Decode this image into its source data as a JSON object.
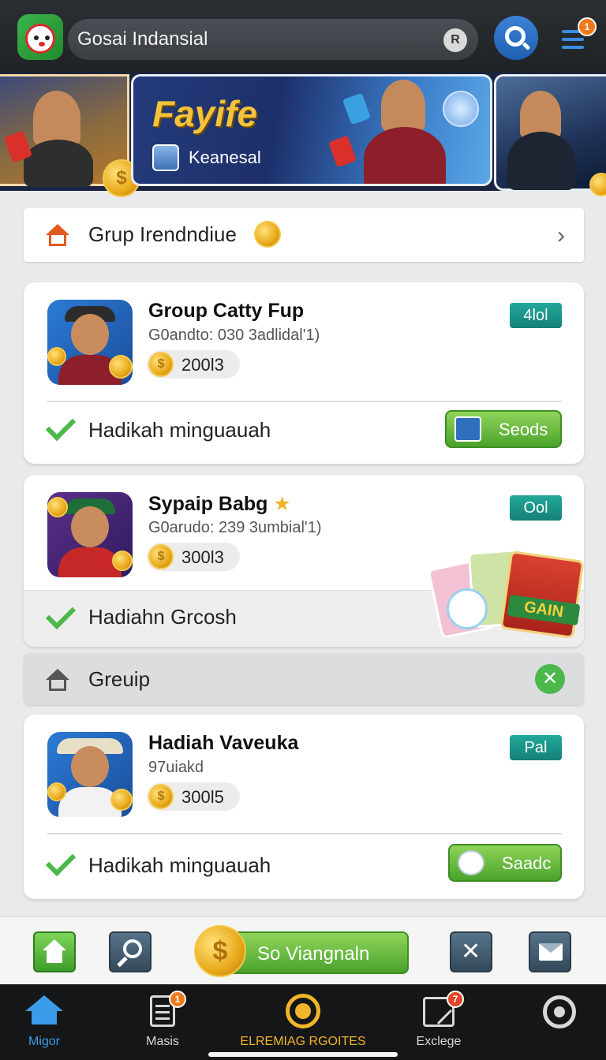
{
  "header": {
    "title": "Gosai Indansial",
    "pill_button_glyph": "R",
    "menu_badge": "1",
    "icons": [
      "app-logo",
      "search-icon",
      "menu-icon"
    ]
  },
  "banner": {
    "title": "Fayife",
    "subtitle": "Keanesal",
    "coin_glyph": "$"
  },
  "sections": [
    {
      "label": "Grup Irendndiue",
      "icon": "house-icon",
      "trailing": "chevron-right-icon",
      "chevron": "›"
    },
    {
      "label": "Greuip",
      "icon": "house-icon",
      "trailing": "close-circle-icon",
      "close": "✕"
    }
  ],
  "cards": [
    {
      "title": "Group Catty Fup",
      "subtitle": "G0andto: 030 3adlidal'1)",
      "amount": "200l3",
      "tag": "4lol",
      "reward": "Hadikah minguauah",
      "button": "Seods"
    },
    {
      "title": "Sypaip Babg",
      "title_star": "★",
      "subtitle": "G0arudo: 239 3umbial'1)",
      "amount": "300l3",
      "tag": "Ool",
      "reward": "Hadiahn Grcosh",
      "art_label": "GAIN"
    },
    {
      "title": "Hadiah Vaveuka",
      "subtitle": "97uiakd",
      "amount": "300l5",
      "tag": "Pal",
      "reward": "Hadikah minguauah",
      "button": "Saadc"
    }
  ],
  "action_bar": {
    "main_button": "So Viangnaln",
    "coin_glyph": "$",
    "x_glyph": "✕"
  },
  "nav": {
    "items": [
      {
        "label": "Migor",
        "icon": "home-icon",
        "active": true
      },
      {
        "label": "Masis",
        "icon": "clipboard-icon",
        "badge": "1"
      },
      {
        "label": "ELREMIAG RGOITES",
        "icon": "target-icon"
      },
      {
        "label": "Exclege",
        "icon": "checkbox-icon",
        "badge": "7"
      },
      {
        "label": "",
        "icon": "search-icon"
      }
    ]
  },
  "colors": {
    "accent_green": "#4aa32c",
    "teal_tag": "#148076",
    "nav_active": "#3b9be8",
    "gold": "#f0b52a"
  }
}
